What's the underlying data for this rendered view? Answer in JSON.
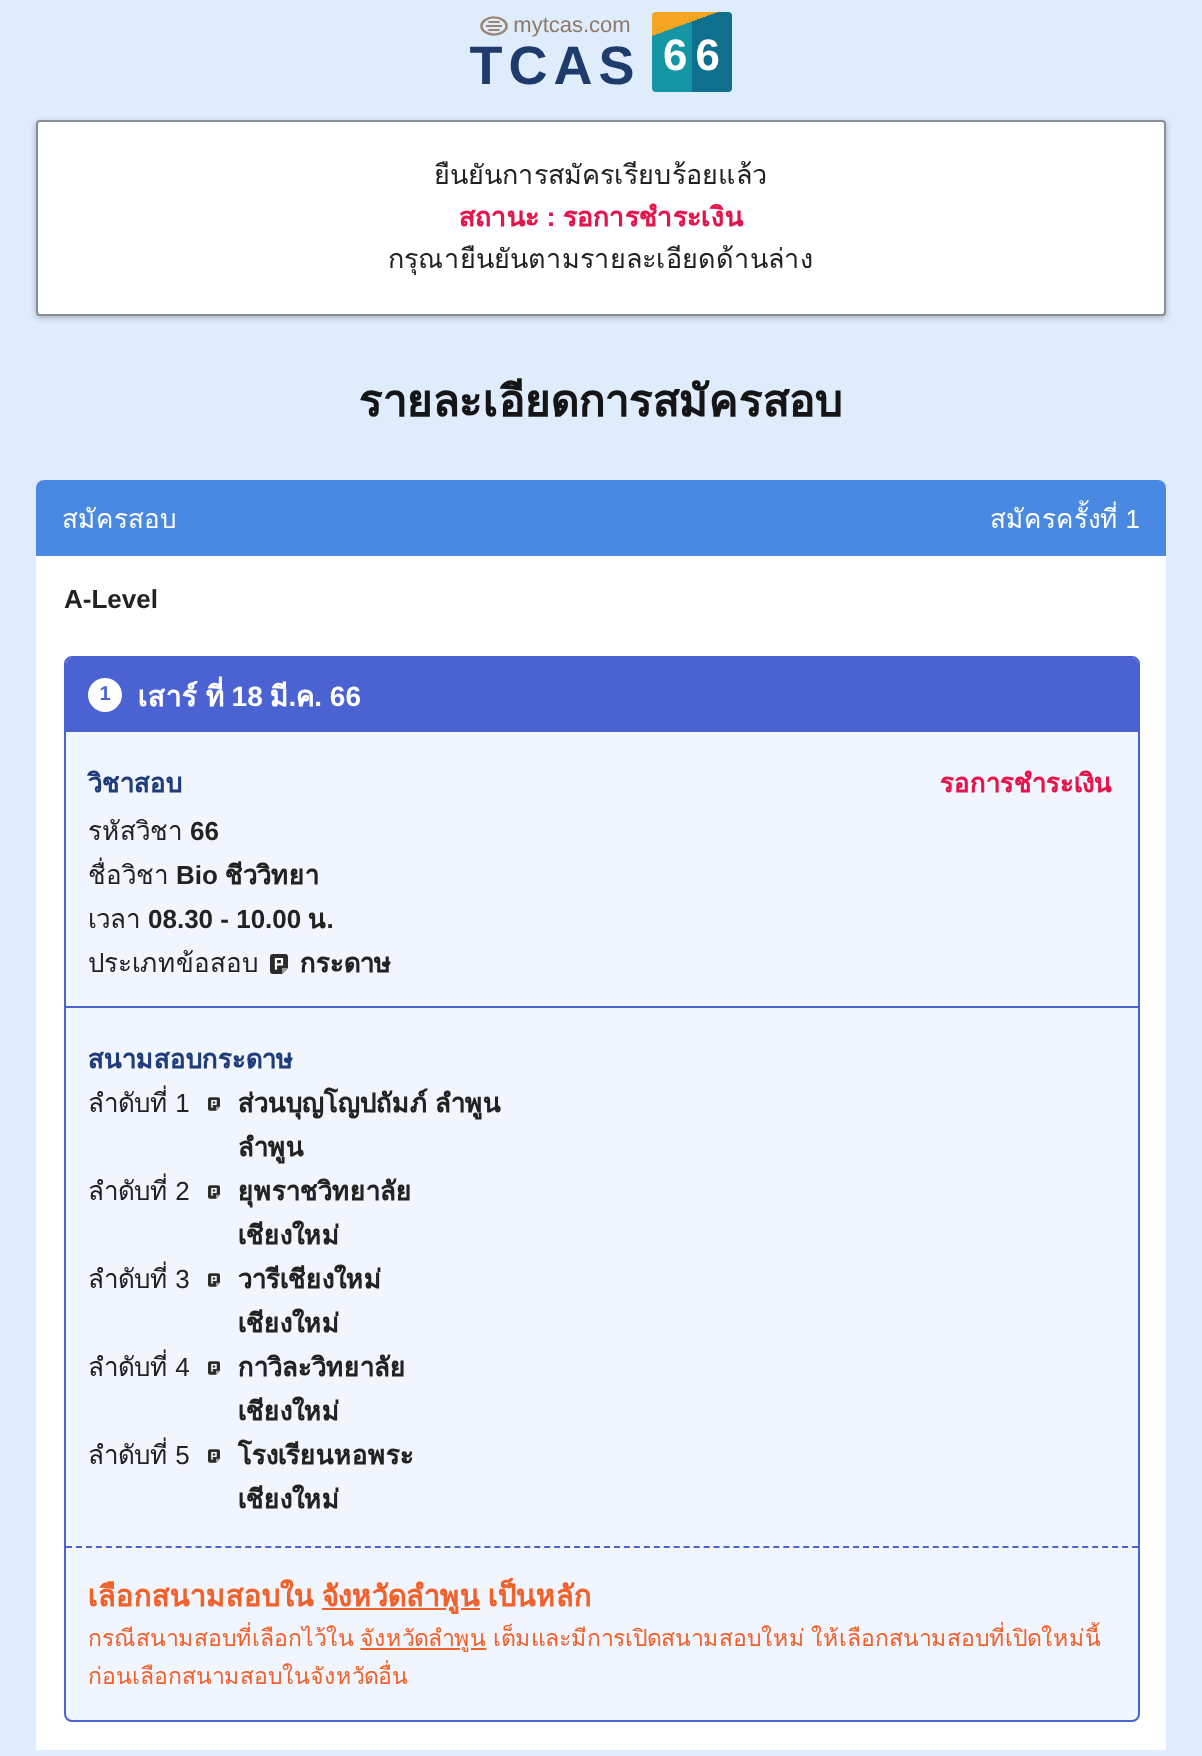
{
  "logo": {
    "site": "mytcas.com",
    "wordmark": "TCAS",
    "number": "66"
  },
  "notice": {
    "message": "ยืนยันการสมัครเรียบร้อยแล้ว",
    "status": "สถานะ : รอการชำระเงิน",
    "instruction": "กรุณายืนยันตามรายละเอียดด้านล่าง"
  },
  "page_title": "รายละเอียดการสมัครสอบ",
  "application": {
    "title": "สมัครสอบ",
    "attempt": "สมัครครั้งที่ 1",
    "exam_type": "A-Level",
    "sessions": [
      {
        "number": "1",
        "date": "เสาร์ ที่ 18 มี.ค. 66",
        "subject": {
          "heading": "วิชาสอบ",
          "status": "รอการชำระเงิน",
          "fields": [
            {
              "kind": "text",
              "label": "รหัสวิชา",
              "value": "66"
            },
            {
              "kind": "text",
              "label": "ชื่อวิชา",
              "value": "Bio ชีววิทยา"
            },
            {
              "kind": "text",
              "label": "เวลา",
              "value": "08.30 - 10.00 น."
            },
            {
              "kind": "paper",
              "label": "ประเภทข้อสอบ",
              "value": "กระดาษ"
            }
          ]
        },
        "venues": {
          "heading": "สนามสอบกระดาษ",
          "items": [
            {
              "rank": "ลำดับที่ 1",
              "name": "ส่วนบุญโญปถัมภ์ ลำพูน",
              "province": "ลำพูน"
            },
            {
              "rank": "ลำดับที่ 2",
              "name": "ยุพราชวิทยาลัย",
              "province": "เชียงใหม่"
            },
            {
              "rank": "ลำดับที่ 3",
              "name": "วารีเชียงใหม่",
              "province": "เชียงใหม่"
            },
            {
              "rank": "ลำดับที่ 4",
              "name": "กาวิละวิทยาลัย",
              "province": "เชียงใหม่"
            },
            {
              "rank": "ลำดับที่ 5",
              "name": "โรงเรียนหอพระ",
              "province": "เชียงใหม่"
            }
          ]
        },
        "note": {
          "title": {
            "before": "เลือกสนามสอบใน",
            "province": "จังหวัดลำพูน",
            "after": "เป็นหลัก"
          },
          "detail": {
            "before": "กรณีสนามสอบที่เลือกไว้ใน",
            "province": "จังหวัดลำพูน",
            "after": "เต็มและมีการเปิดสนามสอบใหม่ ให้เลือกสนามสอบที่เปิดใหม่นี้ก่อนเลือกสนามสอบในจังหวัดอื่น"
          }
        }
      }
    ]
  }
}
